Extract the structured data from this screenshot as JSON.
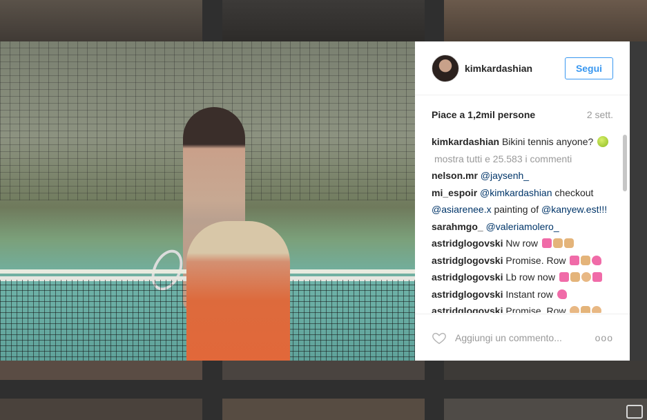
{
  "post": {
    "username": "kimkardashian",
    "follow_label": "Segui",
    "likes": "Piace a 1,2mil persone",
    "time": "2 sett.",
    "caption": "Bikini tennis anyone?",
    "show_all_label": "mostra tutti e 25.583 i commenti",
    "comments": [
      {
        "user": "nelson.mr",
        "text": "@jaysenh_"
      },
      {
        "user": "mi_espoir",
        "mention1": "@kimkardashian",
        "text1": " checkout",
        "mention2": "@asiarenee.x",
        "text2": " painting of ",
        "mention3": "@kanyew.est!!!"
      },
      {
        "user": "sarahmgo_",
        "text": "@valeriamolero_"
      },
      {
        "user": "astridglogovski",
        "text": "Nw row"
      },
      {
        "user": "astridglogovski",
        "text": "Promise. Row"
      },
      {
        "user": "astridglogovski",
        "text": "Lb row now"
      },
      {
        "user": "astridglogovski",
        "text": "Instant row"
      },
      {
        "user": "astridglogovski",
        "text": "Promise. Row"
      }
    ],
    "comment_placeholder": "Aggiungi un commento...",
    "more_label": "ooo"
  },
  "icons": {
    "like": "heart-outline-icon",
    "more": "more-options-icon",
    "emoji": [
      "tennis-ball-icon",
      "heart-emoji-icon",
      "fist-emoji-icon",
      "ok-hand-emoji-icon",
      "hearts-emoji-icon"
    ]
  },
  "colors": {
    "accent": "#3897f0",
    "mention": "#003569",
    "secondary_text": "#999999"
  }
}
